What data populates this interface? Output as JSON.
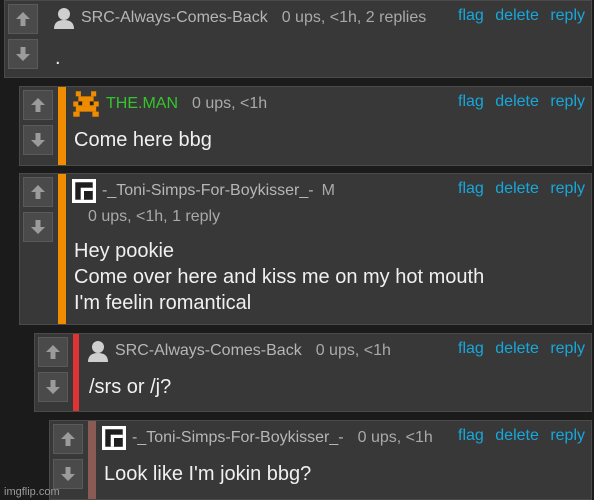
{
  "actions": {
    "flag": "flag",
    "delete": "delete",
    "reply": "reply"
  },
  "comments": [
    {
      "username": "SRC-Always-Comes-Back",
      "meta": "0 ups, <1h, 2 replies",
      "text": "."
    },
    {
      "username": "THE.MAN",
      "meta": "0 ups, <1h",
      "text": "Come here bbg"
    },
    {
      "username": "-_Toni-Simps-For-Boykisser_-",
      "role": "M",
      "meta": "0 ups, <1h, 1 reply",
      "lines": [
        "Hey pookie",
        "Come over here and kiss me on my hot mouth",
        "I'm feelin romantical"
      ]
    },
    {
      "username": "SRC-Always-Comes-Back",
      "meta": "0 ups, <1h",
      "text": "/srs or /j?"
    },
    {
      "username": "-_Toni-Simps-For-Boykisser_-",
      "meta": "0 ups, <1h",
      "text": "Look like I'm jokin bbg?"
    }
  ],
  "watermark": "imgflip.com",
  "colors": {
    "orange_accent": "#f08c00",
    "red_accent": "#e03434",
    "brown_accent": "#8a5a54",
    "link": "#16a8dc",
    "green_user": "#35c42e"
  }
}
